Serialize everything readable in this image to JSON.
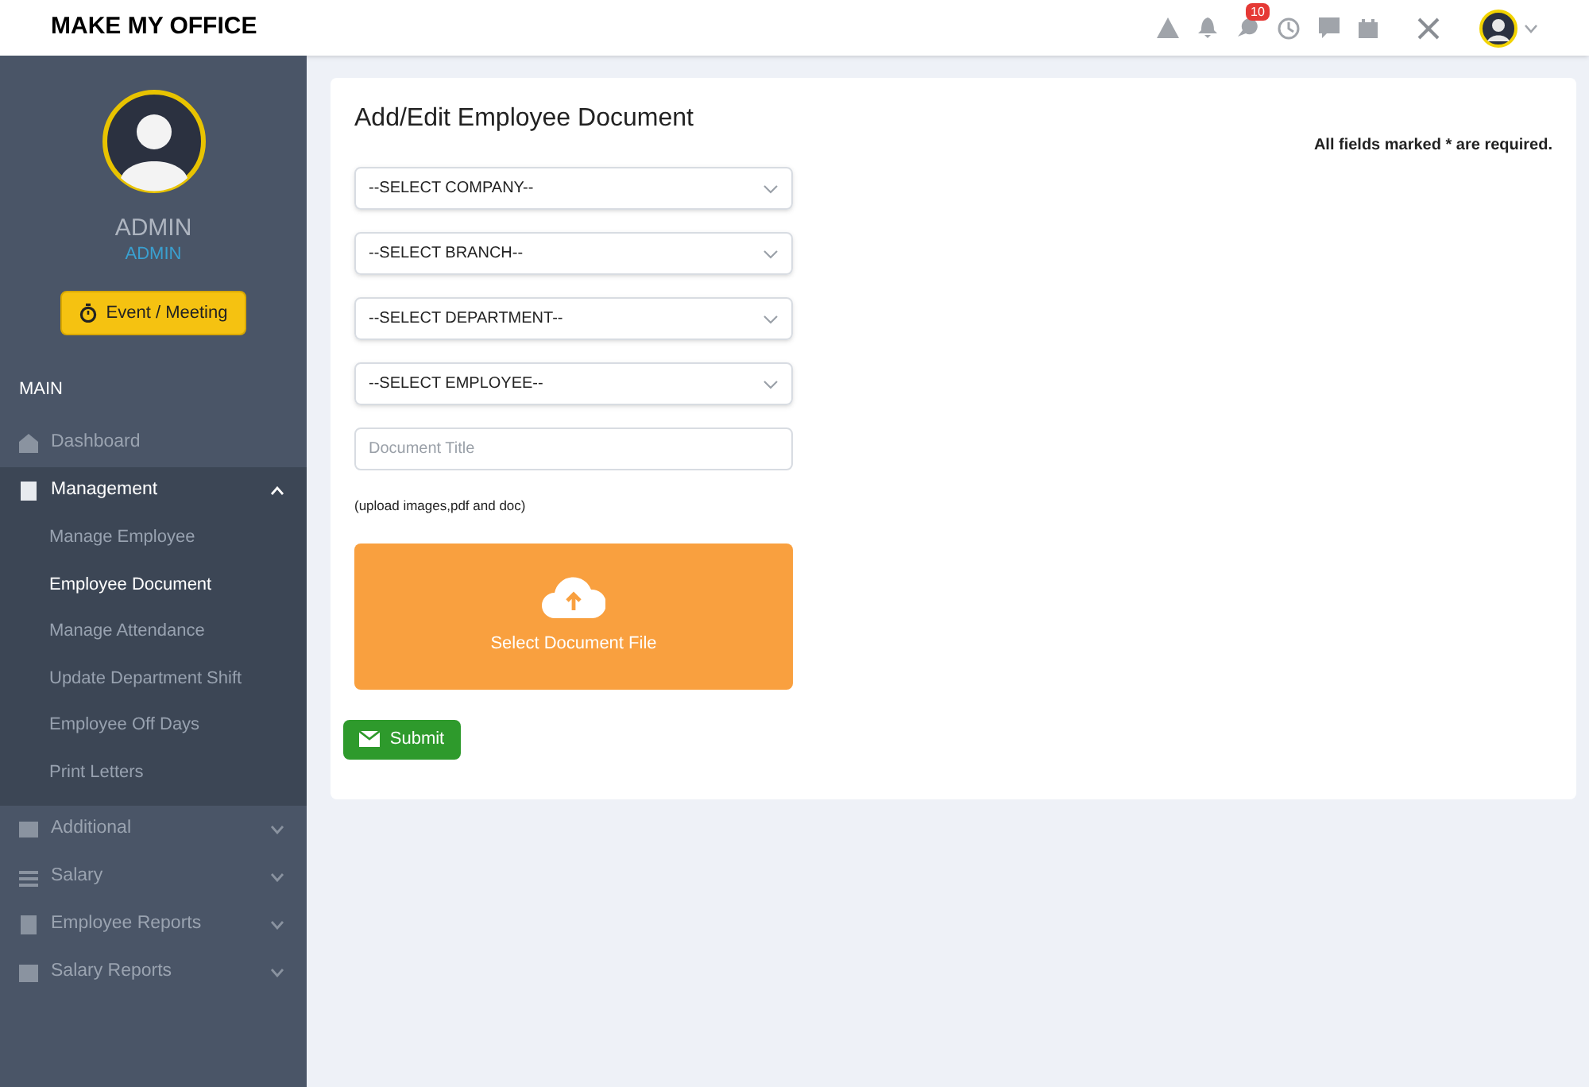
{
  "header": {
    "brand": "MAKE MY OFFICE",
    "notification_count": "10"
  },
  "sidebar": {
    "user_name": "ADMIN",
    "user_role": "ADMIN",
    "event_button": "Event / Meeting",
    "section": "MAIN",
    "items": [
      {
        "label": "Dashboard",
        "kind": "link"
      },
      {
        "label": "Management",
        "kind": "group",
        "expanded": true,
        "children": [
          {
            "label": "Manage Employee",
            "selected": false
          },
          {
            "label": "Employee Document",
            "selected": true
          },
          {
            "label": "Manage Attendance",
            "selected": false
          },
          {
            "label": "Update Department Shift",
            "selected": false
          },
          {
            "label": "Employee Off Days",
            "selected": false
          },
          {
            "label": "Print Letters",
            "selected": false
          }
        ]
      },
      {
        "label": "Additional",
        "kind": "group",
        "expanded": false
      },
      {
        "label": "Salary",
        "kind": "group",
        "expanded": false
      },
      {
        "label": "Employee Reports",
        "kind": "group",
        "expanded": false
      },
      {
        "label": "Salary Reports",
        "kind": "group",
        "expanded": false
      }
    ]
  },
  "form": {
    "title": "Add/Edit Employee Document",
    "required_note": "All fields marked * are required.",
    "selects": [
      "--SELECT COMPANY--",
      "--SELECT BRANCH--",
      "--SELECT DEPARTMENT--",
      "--SELECT EMPLOYEE--"
    ],
    "title_field": {
      "placeholder": "Document Title"
    },
    "upload_hint": "(upload images,pdf and doc)",
    "upload_button": "Select Document File",
    "submit": "Submit"
  }
}
